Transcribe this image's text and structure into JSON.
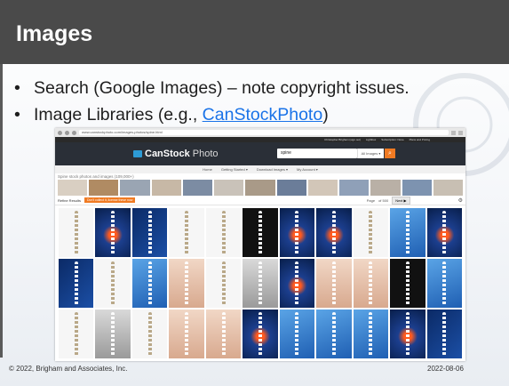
{
  "slide": {
    "title": "Images",
    "bullets": [
      {
        "text": "Search (Google Images) – note copyright issues."
      },
      {
        "prefix": "Image Libraries (e.g., ",
        "link": "CanStockPhoto",
        "suffix": ")"
      }
    ],
    "footer_left": "© 2022, Brigham and Associates, Inc.",
    "footer_right": "2022-08-06"
  },
  "screenshot": {
    "url": "www.canstockphoto.com/images-photos/spine.html",
    "top_links": [
      "Christopher Brigham (sign out)",
      "Lightbox",
      "Subscription: None",
      "Plans and Pricing"
    ],
    "logo_bold": "CanStock",
    "logo_thin": "Photo",
    "search_value": "spine",
    "search_scope": "All Images ▾",
    "search_button_icon": "search-icon",
    "menu": [
      "Home",
      "Getting Started ▾",
      "Download Images ▾",
      "My Account ▾"
    ],
    "related_label": "Spine stock photos and images (109,000+)",
    "refine_label": "Refine Results",
    "promo_label": "Don't collect it, license these now",
    "page_label": "Page",
    "of_label": "of 500",
    "next_label": "Next ▶",
    "grid_rows": [
      [
        "white",
        "darkred",
        "dark",
        "white",
        "white",
        "black",
        "darkred",
        "darkred",
        "white",
        "blue",
        "darkred"
      ],
      [
        "dark",
        "white",
        "blue",
        "skin",
        "white",
        "grey",
        "darkred",
        "skin",
        "skin",
        "black",
        "blue"
      ],
      [
        "white",
        "grey",
        "white",
        "skin",
        "skin",
        "darkred",
        "blue",
        "blue",
        "blue",
        "darkred",
        "dark"
      ]
    ],
    "strip_colors": [
      "#d9cfc2",
      "#b08b63",
      "#9aa5b3",
      "#c7b8a6",
      "#7c8ca3",
      "#c9c2b9",
      "#a99a88",
      "#6b7d99",
      "#d2c6b8",
      "#8fa0b8",
      "#b9b0a6",
      "#7d93b0",
      "#c8bfb3"
    ]
  }
}
